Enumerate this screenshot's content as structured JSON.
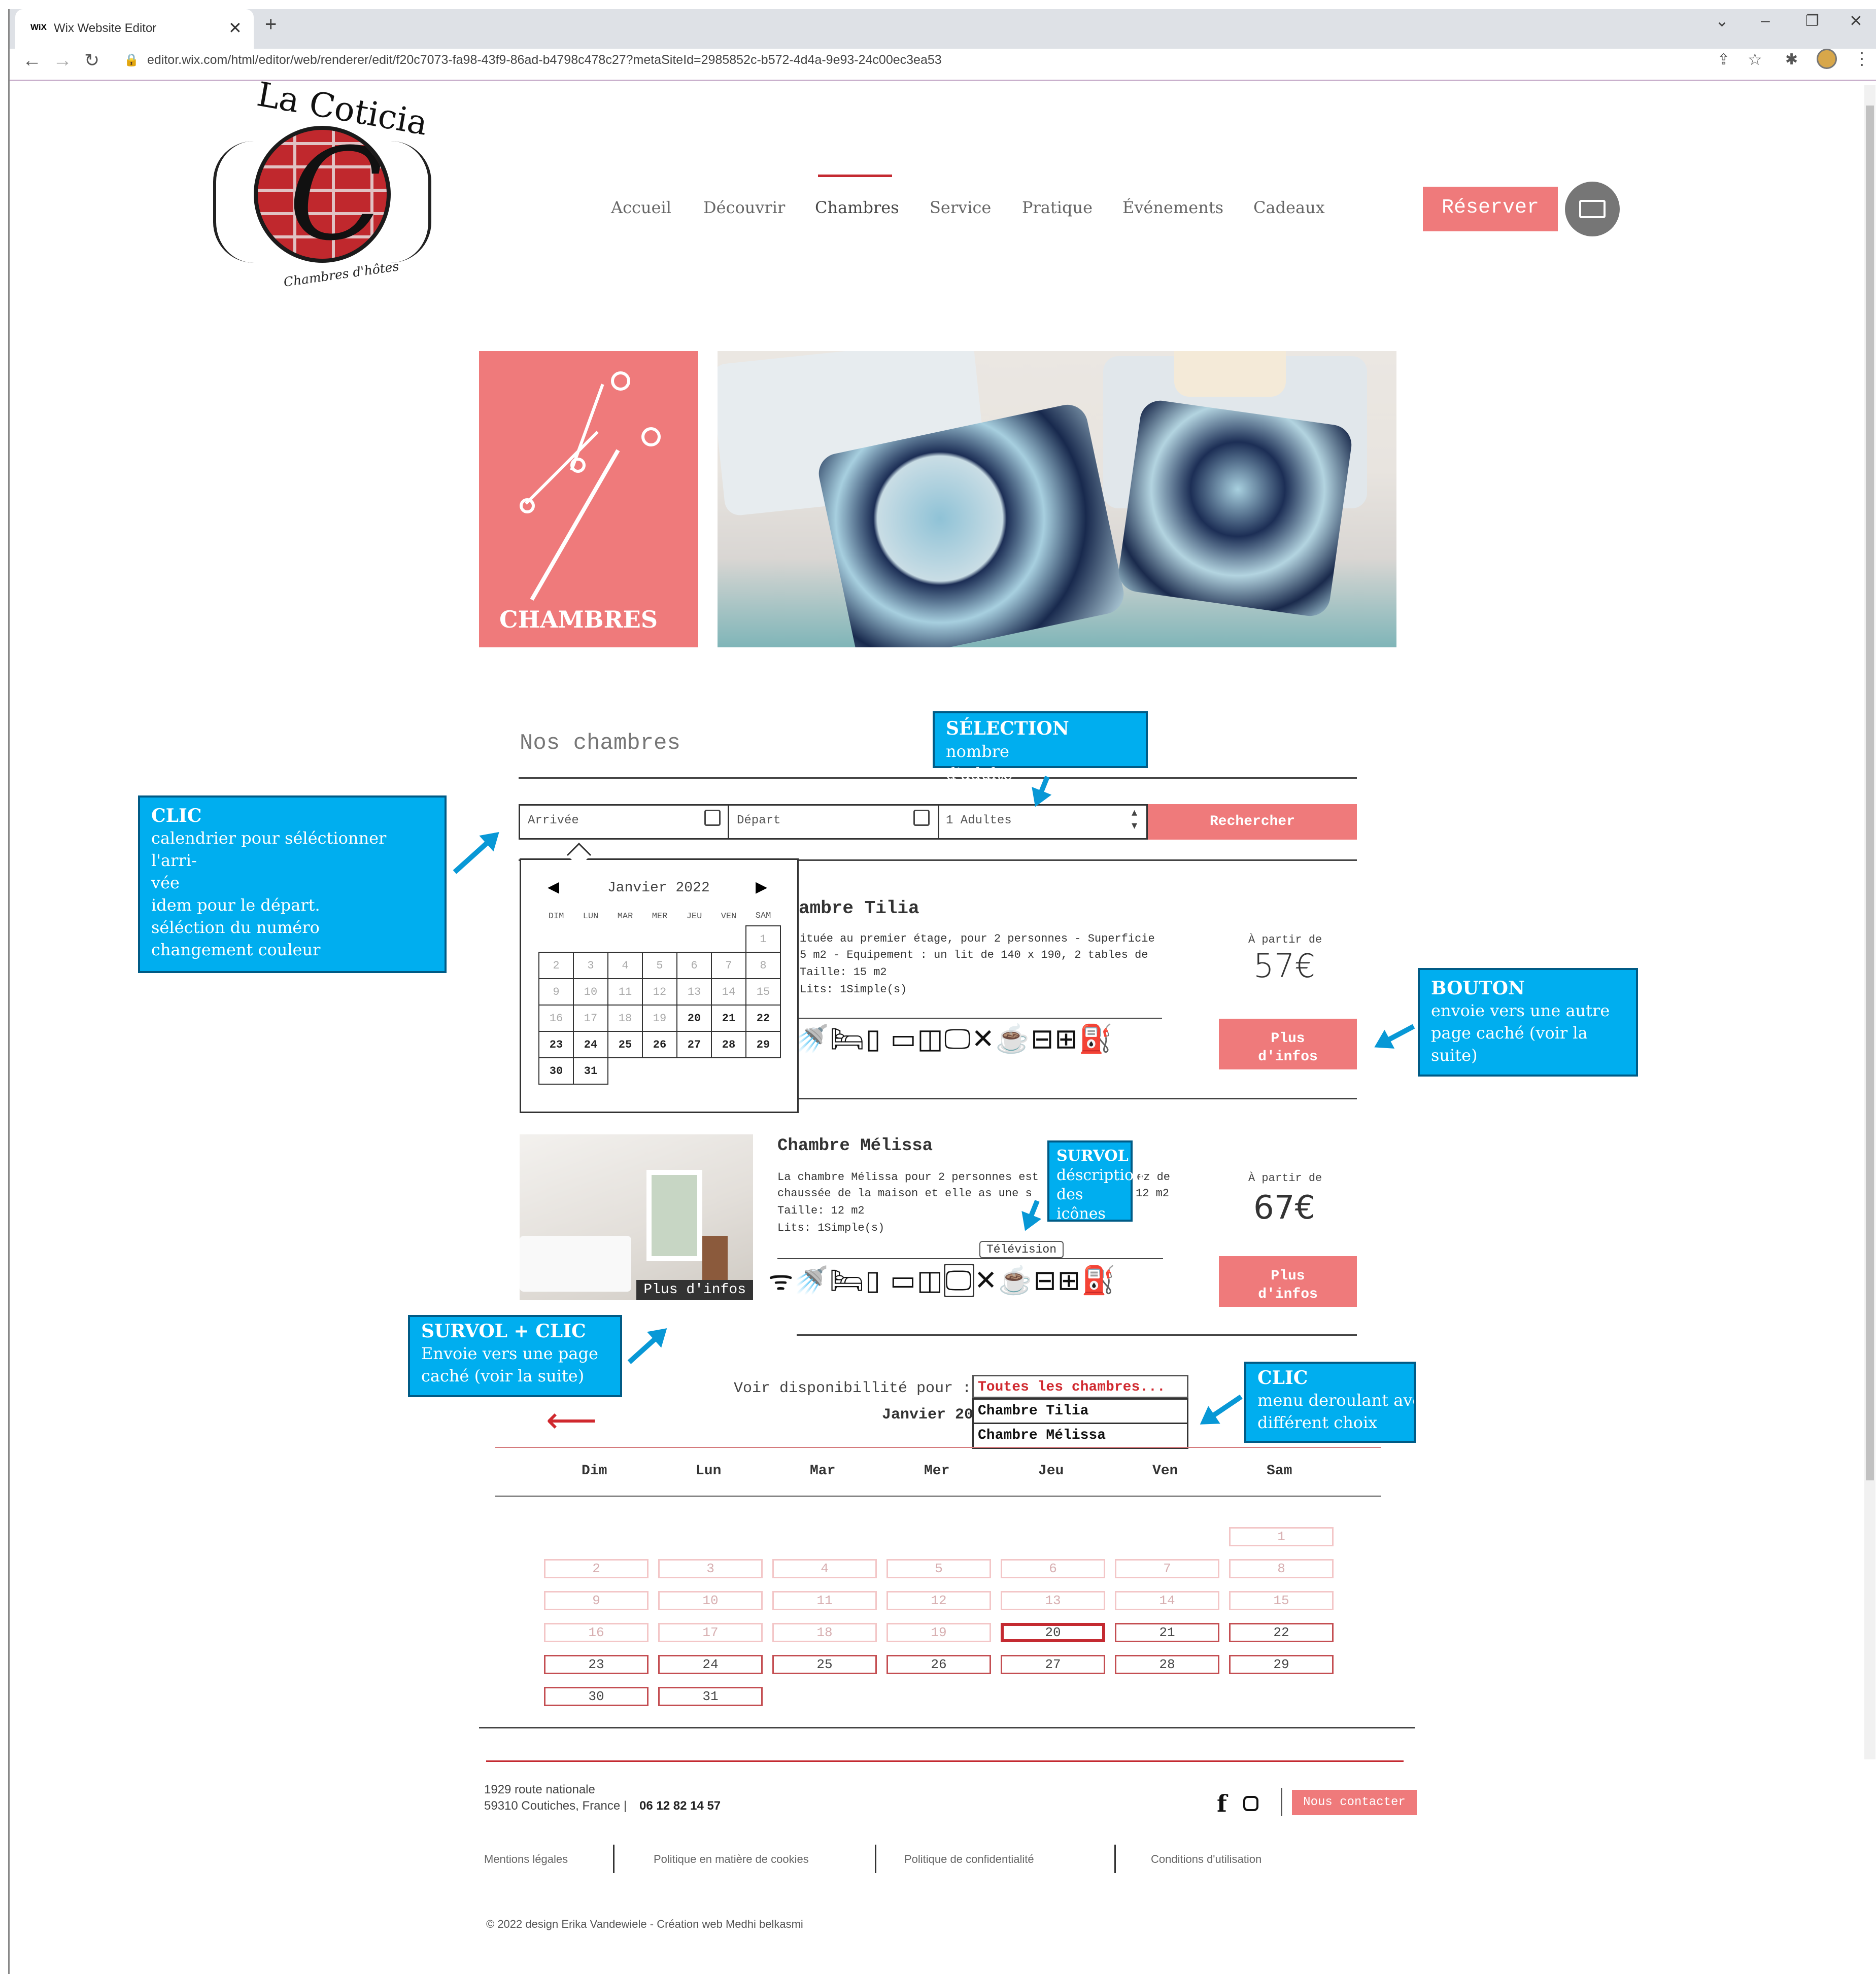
{
  "browser": {
    "tab_title": "Wix Website Editor",
    "tab_favicon": "WiX",
    "url": "editor.wix.com/html/editor/web/renderer/edit/f20c7073-fa98-43f9-86ad-b4798c478c27?metaSiteId=2985852c-b572-4d4a-9e93-24c00ec3ea53"
  },
  "header": {
    "logo_title": "La Coticia",
    "logo_letter": "C",
    "logo_sub": "Chambres d'hôtes",
    "nav": [
      "Accueil",
      "Découvrir",
      "Chambres",
      "Service",
      "Pratique",
      "Événements",
      "Cadeaux"
    ],
    "active_nav": "Chambres",
    "reserve": "Réserver"
  },
  "hero": {
    "label": "CHAMBRES"
  },
  "booking": {
    "title": "Nos chambres",
    "arrival": "Arrivée",
    "departure": "Départ",
    "adults": "1 Adultes",
    "search": "Rechercher"
  },
  "mini_calendar": {
    "month": "Janvier 2022",
    "days": [
      "DIM",
      "LUN",
      "MAR",
      "MER",
      "JEU",
      "VEN",
      "SAM"
    ],
    "weeks": [
      [
        "",
        "",
        "",
        "",
        "",
        "",
        "1"
      ],
      [
        "2",
        "3",
        "4",
        "5",
        "6",
        "7",
        "8"
      ],
      [
        "9",
        "10",
        "11",
        "12",
        "13",
        "14",
        "15"
      ],
      [
        "16",
        "17",
        "18",
        "19",
        "20",
        "21",
        "22"
      ],
      [
        "23",
        "24",
        "25",
        "26",
        "27",
        "28",
        "29"
      ],
      [
        "30",
        "31",
        "",
        "",
        "",
        "",
        ""
      ]
    ],
    "available_from": 20
  },
  "rooms": [
    {
      "name": "ambre Tilia",
      "desc1": "ituée au premier étage, pour 2 personnes - Superficie",
      "desc2": "5 m2 - Equipement : un lit de 140 x 190, 2 tables de",
      "size": "Taille: 15 m2",
      "beds": "Lits: 1Simple(s)",
      "from": "À partir de",
      "price": "57€",
      "more": "Plus d'infos"
    },
    {
      "name": "Chambre Mélissa",
      "desc1": "La chambre Mélissa pour 2 personnes est",
      "desc1b": "ez de",
      "desc2": "chaussée de la maison et elle as une s",
      "desc2b": "12 m2",
      "size": "Taille: 12 m2",
      "beds": "Lits: 1Simple(s)",
      "from": "À partir de",
      "price": "67€",
      "more": "Plus d'infos",
      "image_overlay": "Plus d'infos",
      "tooltip": "Télévision"
    }
  ],
  "availability": {
    "label": "Voir disponibillité pour :",
    "selected": "Toutes les chambres...",
    "options": [
      "Chambre Tilia",
      "Chambre Mélissa"
    ],
    "month_partial": "Janvier 20",
    "days": [
      "Dim",
      "Lun",
      "Mar",
      "Mer",
      "Jeu",
      "Ven",
      "Sam"
    ]
  },
  "footer": {
    "address1": "1929 route nationale",
    "address2": "59310 Coutiches, France |",
    "phone": "06 12 82 14 57",
    "contact": "Nous contacter",
    "links": [
      "Mentions légales",
      "Politique en matière de cookies",
      "Politique de confidentialité",
      "Conditions d'utilisation"
    ],
    "copyright": "© 2022 design Erika Vandewiele - Création web  Medhi belkasmi"
  },
  "annotations": {
    "a1": {
      "title": "CLIC",
      "lines": [
        "calendrier pour séléctionner l'arri-",
        "vée",
        "idem pour le départ.",
        "séléction du numéro",
        "changement couleur"
      ]
    },
    "a2": {
      "title": "SÉLECTION",
      "rest": " nombre",
      "line2": "d'adulte"
    },
    "a3": {
      "title": "BOUTON",
      "lines": [
        "envoie vers une autre",
        "page caché  (voir la suite)"
      ]
    },
    "a4": {
      "title": "SURVOL",
      "lines": [
        "déscription",
        "des icônes"
      ]
    },
    "a5": {
      "title": "SURVOL + CLIC",
      "lines": [
        "Envoie vers une page",
        "caché (voir la suite)"
      ]
    },
    "a6": {
      "title": "CLIC",
      "lines": [
        "menu deroulant avec",
        "différent choix"
      ]
    }
  },
  "colors": {
    "accent": "#ef7a7b",
    "annotation": "#00aeef",
    "selected": "#c42a31"
  }
}
